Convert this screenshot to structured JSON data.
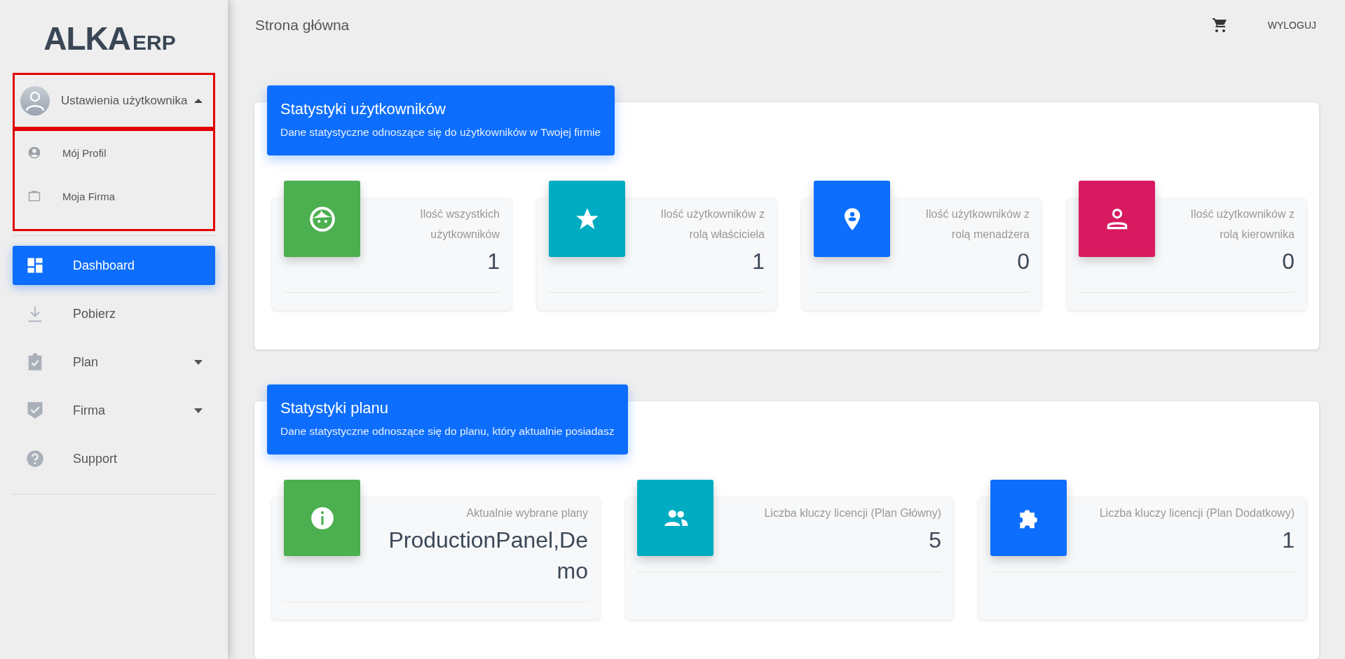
{
  "logo": {
    "main": "ALKA",
    "suffix": "ERP"
  },
  "user_menu": {
    "label": "Ustawienia użytkownika",
    "expanded": true,
    "highlighted": true,
    "items": [
      {
        "label": "Mój Profil",
        "kind": "account"
      },
      {
        "label": "Moja Firma",
        "kind": "briefcase"
      }
    ]
  },
  "nav": [
    {
      "label": "Dashboard",
      "kind": "dashboard",
      "selected": true,
      "expandable": false
    },
    {
      "label": "Pobierz",
      "kind": "download",
      "selected": false,
      "expandable": false
    },
    {
      "label": "Plan",
      "kind": "clipboard",
      "selected": false,
      "expandable": true
    },
    {
      "label": "Firma",
      "kind": "shield",
      "selected": false,
      "expandable": true
    },
    {
      "label": "Support",
      "kind": "help",
      "selected": false,
      "expandable": false
    }
  ],
  "header": {
    "title": "Strona główna",
    "logout": "WYLOGUJ"
  },
  "sections": [
    {
      "title": "Statystyki użytkowników",
      "subtitle": "Dane statystyczne odnoszące się do użytkowników w Twojej firmie",
      "stats": [
        {
          "label": "Ilość wszystkich użytkowników",
          "value": "1",
          "kind": "face",
          "color": "#4caf50"
        },
        {
          "label": "Ilość użytkowników z rolą właściciela",
          "value": "1",
          "kind": "star",
          "color": "#00acc1"
        },
        {
          "label": "Ilość użytkowników z rolą menadżera",
          "value": "0",
          "kind": "pin",
          "color": "#0d6efd"
        },
        {
          "label": "Ilość użytkowników z rolą kierownika",
          "value": "0",
          "kind": "person",
          "color": "#d81b60"
        }
      ]
    },
    {
      "title": "Statystyki planu",
      "subtitle": "Dane statystyczne odnoszące się do planu, który aktualnie posiadasz",
      "stats": [
        {
          "label": "Aktualnie wybrane plany",
          "value": "ProductionPanel,Demo",
          "kind": "info",
          "color": "#4caf50"
        },
        {
          "label": "Liczba kluczy licencji (Plan Główny)",
          "value": "5",
          "kind": "people",
          "color": "#00acc1"
        },
        {
          "label": "Liczba kluczy licencji (Plan Dodatkowy)",
          "value": "1",
          "kind": "puzzle",
          "color": "#0d6efd"
        }
      ]
    }
  ]
}
